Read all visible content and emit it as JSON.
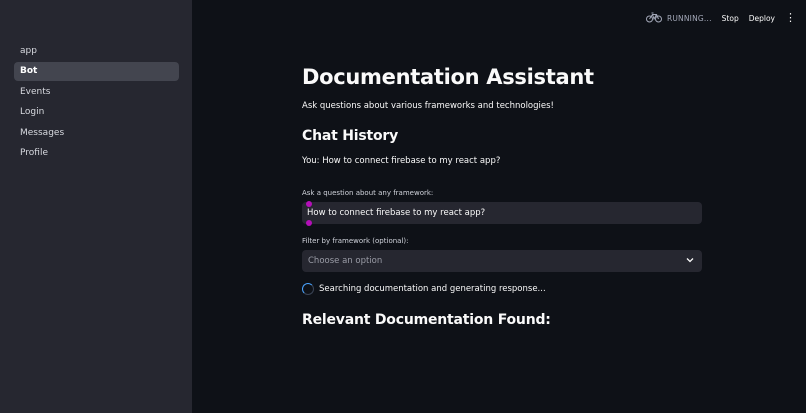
{
  "sidebar": {
    "items": [
      {
        "label": "app"
      },
      {
        "label": "Bot"
      },
      {
        "label": "Events"
      },
      {
        "label": "Login"
      },
      {
        "label": "Messages"
      },
      {
        "label": "Profile"
      }
    ],
    "active": "Bot"
  },
  "toolbar": {
    "status": "RUNNING...",
    "status_icon": "bicycle-icon",
    "stop_label": "Stop",
    "deploy_label": "Deploy",
    "menu_icon": "vertical-ellipsis-icon"
  },
  "main": {
    "title": "Documentation Assistant",
    "subtitle": "Ask questions about various frameworks and technologies!",
    "history_heading": "Chat History",
    "chat_line": "You: How to connect firebase to my react app?",
    "question_label": "Ask a question about any framework:",
    "question_value": "How to connect firebase to my react app?",
    "filter_label": "Filter by framework (optional):",
    "filter_placeholder": "Choose an option",
    "spinner_text": "Searching documentation and generating response...",
    "results_heading": "Relevant Documentation Found:"
  },
  "colors": {
    "background": "#0e1117",
    "sidebar": "#262730",
    "accent_pin": "#b30fb8",
    "spinner": "#4aa4ff"
  }
}
